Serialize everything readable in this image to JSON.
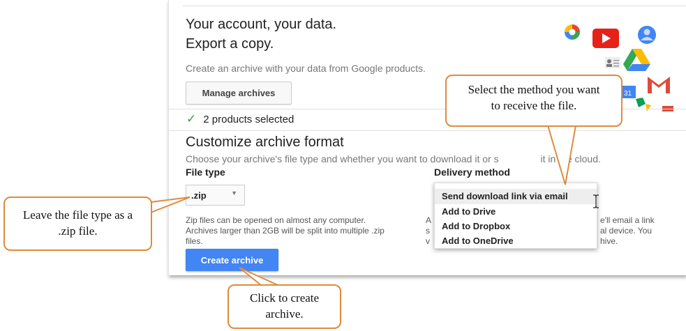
{
  "header": {
    "title_line1": "Your account, your data.",
    "title_line2": "Export a copy.",
    "subtitle": "Create an archive with your data from Google products.",
    "manage_archives_label": "Manage archives"
  },
  "selection": {
    "products_selected": "2 products selected"
  },
  "customize": {
    "heading": "Customize archive format",
    "description": "Choose your archive's file type and whether you want to download it or s",
    "description_tail": "it in the cloud."
  },
  "file_type": {
    "label": "File type",
    "selected": ".zip",
    "help_line1": "Zip files can be opened on almost any computer.",
    "help_line2": "Archives larger than 2GB will be split into multiple .zip",
    "help_line3": "files."
  },
  "delivery": {
    "label": "Delivery method",
    "options": [
      "Send download link via email",
      "Add to Drive",
      "Add to Dropbox",
      "Add to OneDrive"
    ],
    "selected_index": 0,
    "help_left_char": "A",
    "help_left_char2": "v",
    "help_mid_char": "s",
    "help_right_line1": "e'll email a link",
    "help_right_line2": "al device. You",
    "help_right_line3": "hive."
  },
  "actions": {
    "create_archive_label": "Create archive"
  },
  "callouts": {
    "delivery": "Select the method you want to receive the file.",
    "file_type": "Leave the file type as a .zip file.",
    "create": "Click to create archive."
  },
  "product_icons": [
    "photos-icon",
    "youtube-icon",
    "contacts-icon",
    "tasks-icon",
    "drive-icon",
    "gmail-icon",
    "calendar-icon",
    "hangouts-icon"
  ],
  "colors": {
    "accent_blue": "#4285f4",
    "callout_border": "#e08a3c",
    "check_green": "#3c9a4a"
  }
}
